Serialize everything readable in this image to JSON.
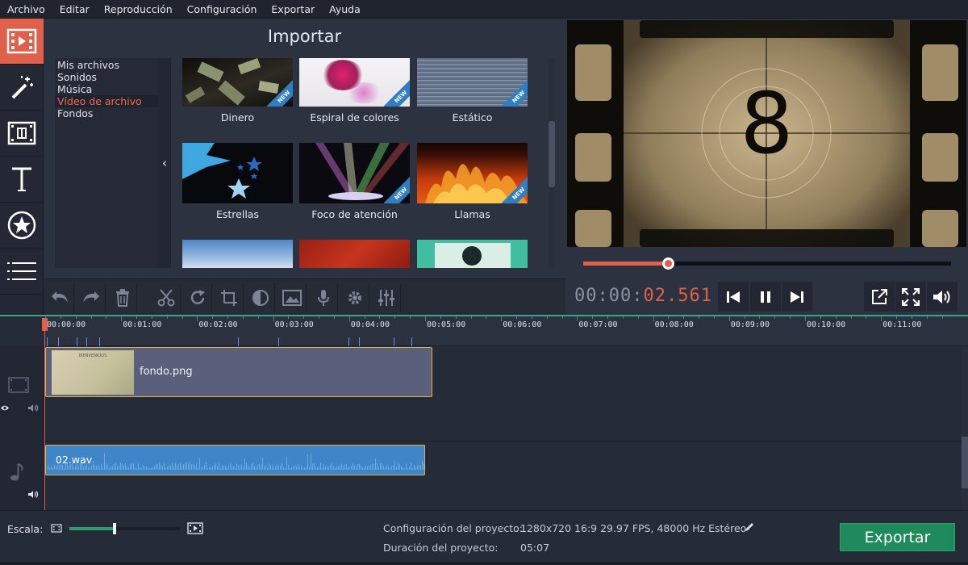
{
  "menu": [
    "Archivo",
    "Editar",
    "Reproducción",
    "Configuración",
    "Exportar",
    "Ayuda"
  ],
  "tools": [
    {
      "name": "import-tool",
      "icon": "film-import-icon"
    },
    {
      "name": "filters-tool",
      "icon": "magic-wand-icon"
    },
    {
      "name": "transitions-tool",
      "icon": "transition-icon"
    },
    {
      "name": "titles-tool",
      "icon": "text-icon"
    },
    {
      "name": "stickers-tool",
      "icon": "star-sticker-icon"
    },
    {
      "name": "more-tools",
      "icon": "list-icon"
    }
  ],
  "import_panel": {
    "title": "Importar",
    "categories": [
      {
        "label": "Mis archivos",
        "selected": false
      },
      {
        "label": "Sonidos",
        "selected": false
      },
      {
        "label": "Música",
        "selected": false
      },
      {
        "label": "Vídeo de archivo",
        "selected": true
      },
      {
        "label": "Fondos",
        "selected": false
      }
    ],
    "collapse_glyph": "‹",
    "new_badge": "NEW",
    "items": [
      {
        "label": "Dinero",
        "new": true
      },
      {
        "label": "Espiral de colores",
        "new": true
      },
      {
        "label": "Estático",
        "new": true
      },
      {
        "label": "Estrellas",
        "new": false
      },
      {
        "label": "Foco de atención",
        "new": true
      },
      {
        "label": "Llamas",
        "new": true
      },
      {
        "label": "",
        "new": false
      },
      {
        "label": "",
        "new": false
      },
      {
        "label": "",
        "new": false
      }
    ]
  },
  "edit_toolbar": [
    "undo-icon",
    "redo-icon",
    "trash-icon",
    "scissors-icon",
    "rotate-icon",
    "crop-icon",
    "color-adjust-icon",
    "image-icon",
    "microphone-icon",
    "gear-icon",
    "equalizer-icon"
  ],
  "preview": {
    "countdown_number": "8",
    "progress": 0.23,
    "timecode_dim": "00:00:",
    "timecode_hot": "02.561"
  },
  "timeline": {
    "ticks": [
      "00:00:00",
      "00:01:00",
      "00:02:00",
      "00:03:00",
      "00:04:00",
      "00:05:00",
      "00:06:00",
      "00:07:00",
      "00:08:00",
      "00:09:00",
      "00:10:00",
      "00:11:00"
    ],
    "video_clip": {
      "name": "fondo.png",
      "thumb_text": "BIENVENIDOS"
    },
    "audio_clip": {
      "name": "02.wav"
    }
  },
  "bottom": {
    "scale_label": "Escala:",
    "zoom_level": 0.41,
    "project_config_label": "Configuración del proyecto:",
    "project_config_value": "1280x720 16:9 29.97 FPS, 48000 Hz Estéreo",
    "project_duration_label": "Duración del proyecto:",
    "project_duration_value": "05:07",
    "export_label": "Exportar"
  },
  "colors": {
    "accent": "#e0614b",
    "export": "#1f8a5c",
    "audio_clip": "#3f86c8",
    "timeline_line": "#3aa487"
  }
}
